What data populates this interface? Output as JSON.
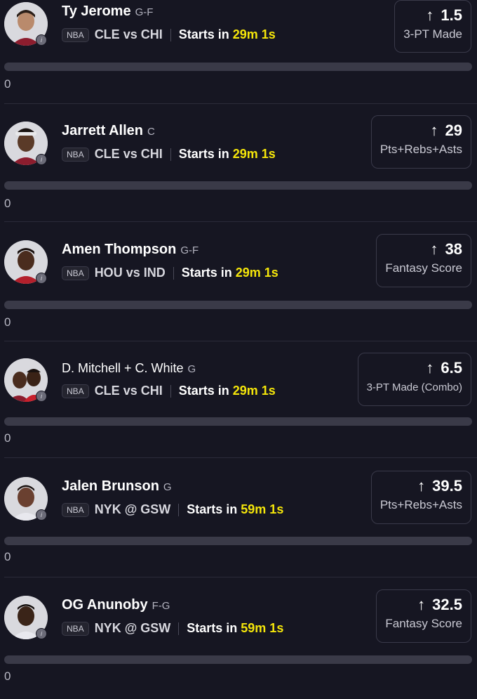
{
  "colors": {
    "background": "#161622",
    "countdown": "#f5e60a",
    "track": "#3a3a48",
    "border": "#3a3a4a"
  },
  "icons": {
    "trend": "arrow-up-icon",
    "info": "info-icon"
  },
  "cards": [
    {
      "name": "Ty Jerome",
      "position": "G-F",
      "league": "NBA",
      "matchup": "CLE vs CHI",
      "starts_label": "Starts in",
      "countdown": "29m 1s",
      "arrow": "↑",
      "line": "1.5",
      "stat": "3-PT Made",
      "progress": 0,
      "progress_label": "0"
    },
    {
      "name": "Jarrett Allen",
      "position": "C",
      "league": "NBA",
      "matchup": "CLE vs CHI",
      "starts_label": "Starts in",
      "countdown": "29m 1s",
      "arrow": "↑",
      "line": "29",
      "stat": "Pts+Rebs+Asts",
      "progress": 0,
      "progress_label": "0"
    },
    {
      "name": "Amen Thompson",
      "position": "G-F",
      "league": "NBA",
      "matchup": "HOU vs IND",
      "starts_label": "Starts in",
      "countdown": "29m 1s",
      "arrow": "↑",
      "line": "38",
      "stat": "Fantasy Score",
      "progress": 0,
      "progress_label": "0"
    },
    {
      "name": "D. Mitchell + C. White",
      "position": "G",
      "league": "NBA",
      "matchup": "CLE vs CHI",
      "starts_label": "Starts in",
      "countdown": "29m 1s",
      "arrow": "↑",
      "line": "6.5",
      "stat": "3-PT Made (Combo)",
      "progress": 0,
      "progress_label": "0"
    },
    {
      "name": "Jalen Brunson",
      "position": "G",
      "league": "NBA",
      "matchup": "NYK @ GSW",
      "starts_label": "Starts in",
      "countdown": "59m 1s",
      "arrow": "↑",
      "line": "39.5",
      "stat": "Pts+Rebs+Asts",
      "progress": 0,
      "progress_label": "0"
    },
    {
      "name": "OG Anunoby",
      "position": "F-G",
      "league": "NBA",
      "matchup": "NYK @ GSW",
      "starts_label": "Starts in",
      "countdown": "59m 1s",
      "arrow": "↑",
      "line": "32.5",
      "stat": "Fantasy Score",
      "progress": 0,
      "progress_label": "0"
    }
  ]
}
